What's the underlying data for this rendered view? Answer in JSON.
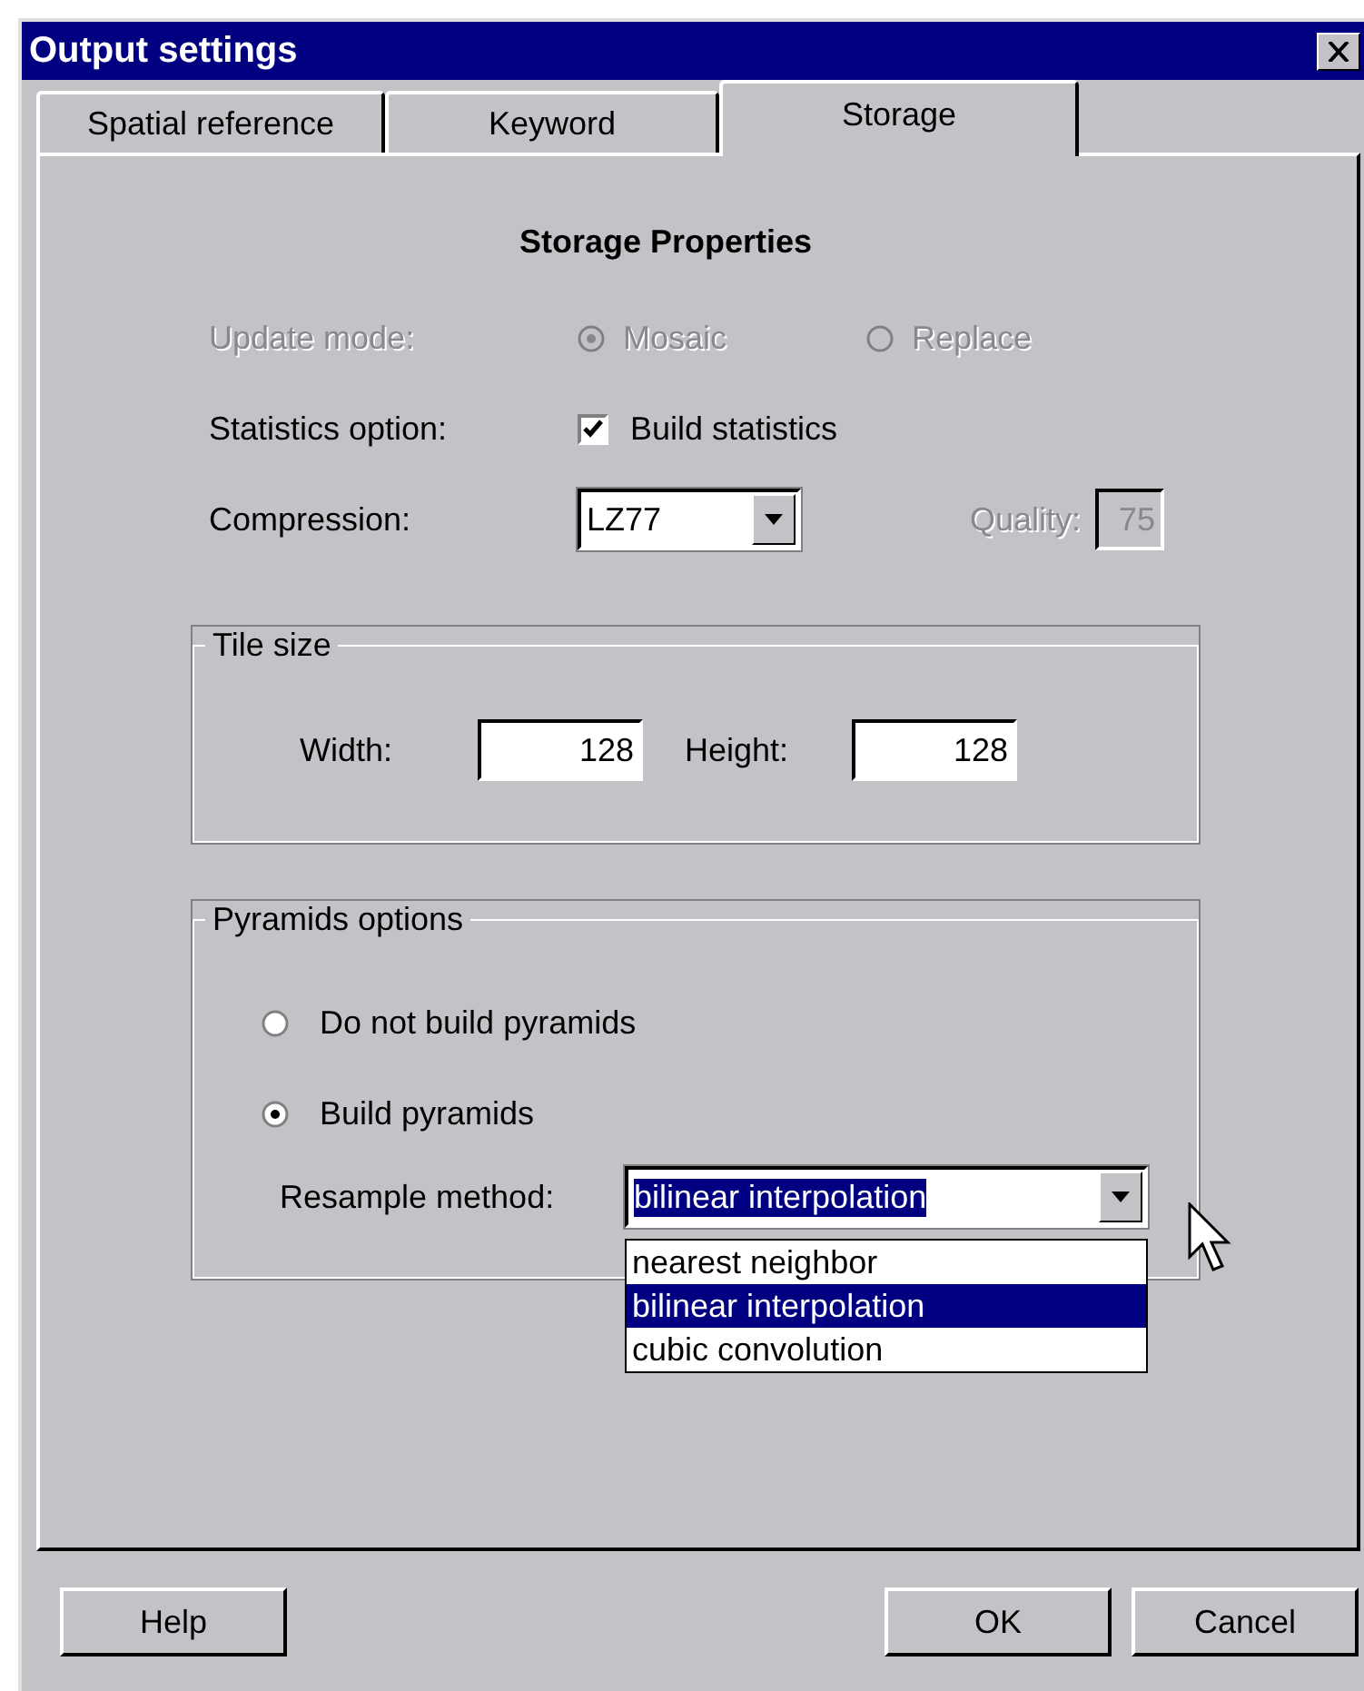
{
  "window": {
    "title": "Output settings"
  },
  "tabs": [
    {
      "label": "Spatial reference",
      "selected": false
    },
    {
      "label": "Keyword",
      "selected": false
    },
    {
      "label": "Storage",
      "selected": true
    }
  ],
  "heading": "Storage Properties",
  "update_mode": {
    "label": "Update mode:",
    "disabled": true,
    "options": [
      {
        "label": "Mosaic",
        "selected": true
      },
      {
        "label": "Replace",
        "selected": false
      }
    ]
  },
  "statistics": {
    "label": "Statistics option:",
    "checkbox": {
      "label": "Build statistics",
      "checked": true
    }
  },
  "compression": {
    "label": "Compression:",
    "value": "LZ77",
    "quality": {
      "label": "Quality:",
      "value": "75",
      "disabled": true
    }
  },
  "tile_size": {
    "title": "Tile size",
    "width": {
      "label": "Width:",
      "value": "128"
    },
    "height": {
      "label": "Height:",
      "value": "128"
    }
  },
  "pyramids": {
    "title": "Pyramids options",
    "options": [
      {
        "label": "Do not build pyramids",
        "selected": false
      },
      {
        "label": "Build pyramids",
        "selected": true
      }
    ],
    "resample": {
      "label": "Resample method:",
      "value": "bilinear interpolation",
      "expanded": true,
      "items": [
        {
          "label": "nearest neighbor",
          "selected": false
        },
        {
          "label": "bilinear interpolation",
          "selected": true
        },
        {
          "label": "cubic convolution",
          "selected": false
        }
      ]
    }
  },
  "buttons": [
    {
      "label": "Help"
    },
    {
      "label": "OK"
    },
    {
      "label": "Cancel"
    }
  ]
}
